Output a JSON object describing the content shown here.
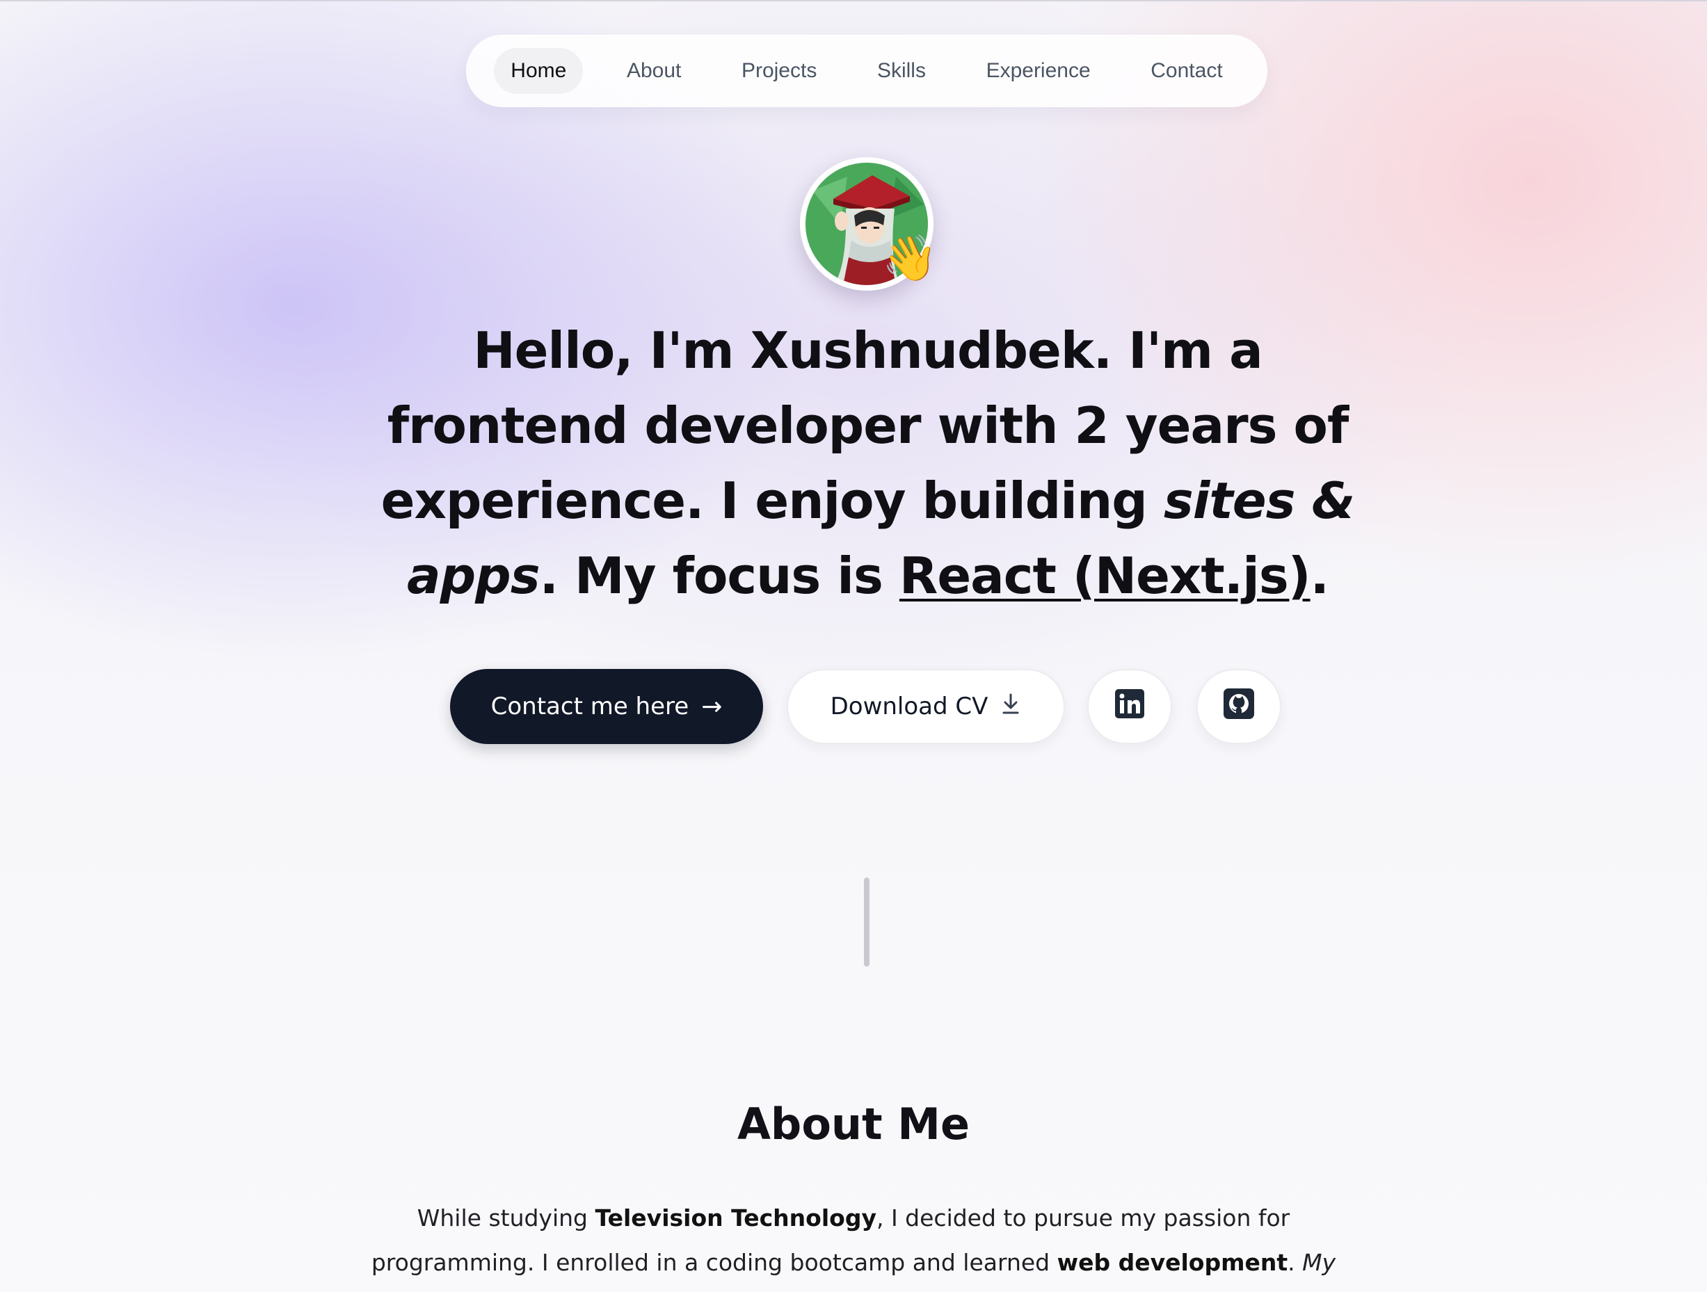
{
  "nav": {
    "items": [
      "Home",
      "About",
      "Projects",
      "Skills",
      "Experience",
      "Contact"
    ],
    "active": "Home"
  },
  "hero": {
    "avatar_alt": "anime-character-avatar",
    "wave_emoji": "👋",
    "headline": {
      "part1_bold": "Hello, I'm Xushnudbek.",
      "part2": " I'm a ",
      "part3_bold": "frontend developer",
      "part4": " with ",
      "part5_bold": "2 years",
      "part6": " of experience. I enjoy building ",
      "part7_italic": "sites & apps",
      "part8": ". My focus is ",
      "part9_underline": "React (Next.js)",
      "part10": "."
    },
    "buttons": {
      "contact_label": "Contact me here",
      "contact_icon": "→",
      "cv_label": "Download CV",
      "linkedin_icon": "linkedin-icon",
      "github_icon": "github-icon"
    }
  },
  "about": {
    "title": "About Me",
    "text": {
      "p1": "While studying ",
      "p2_bold": "Television Technology",
      "p3": ", I decided to pursue my passion for programming. I enrolled in a coding bootcamp and learned ",
      "p4_bold": "web development",
      "p5": ". ",
      "p6_italic": "My favorite part of programming"
    }
  },
  "colors": {
    "dark_button": "#111827",
    "text": "#0f0f14",
    "nav_active_bg": "#f1f1f4"
  }
}
